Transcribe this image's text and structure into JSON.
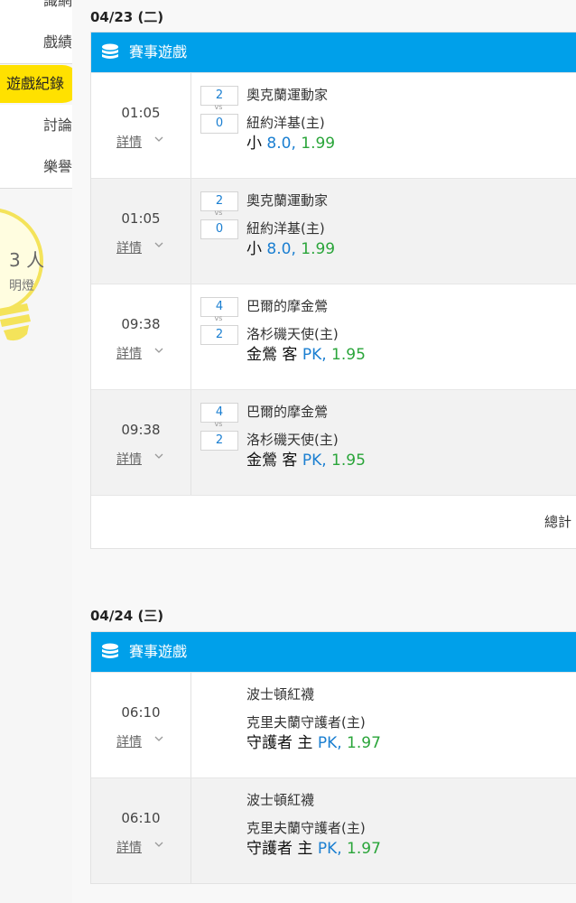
{
  "sidebar": {
    "items": [
      {
        "label": "識網"
      },
      {
        "label": "戲績"
      },
      {
        "label": "遊戲紀錄"
      },
      {
        "label": "討論"
      },
      {
        "label": "樂譽"
      }
    ],
    "bulb_count": "3 人",
    "bulb_label": "明燈"
  },
  "days": [
    {
      "date": "04/23 (二)",
      "section_title": "賽事遊戲",
      "games": [
        {
          "time": "01:05",
          "detail": "詳情",
          "away_score": "2",
          "home_score": "0",
          "vs": "vs",
          "away": "奧克蘭運動家",
          "home": "紐約洋基(主)",
          "pick": "小",
          "line": "8.0,",
          "odds": "1.99"
        },
        {
          "time": "01:05",
          "detail": "詳情",
          "away_score": "2",
          "home_score": "0",
          "vs": "vs",
          "away": "奧克蘭運動家",
          "home": "紐約洋基(主)",
          "pick": "小",
          "line": "8.0,",
          "odds": "1.99"
        },
        {
          "time": "09:38",
          "detail": "詳情",
          "away_score": "4",
          "home_score": "2",
          "vs": "vs",
          "away": "巴爾的摩金鶯",
          "home": "洛杉磯天使(主)",
          "pick": "金鶯 客",
          "line": "PK,",
          "odds": "1.95"
        },
        {
          "time": "09:38",
          "detail": "詳情",
          "away_score": "4",
          "home_score": "2",
          "vs": "vs",
          "away": "巴爾的摩金鶯",
          "home": "洛杉磯天使(主)",
          "pick": "金鶯 客",
          "line": "PK,",
          "odds": "1.95"
        }
      ],
      "total_label": "總計"
    },
    {
      "date": "04/24 (三)",
      "section_title": "賽事遊戲",
      "games": [
        {
          "time": "06:10",
          "detail": "詳情",
          "away": "波士頓紅襪",
          "home": "克里夫蘭守護者(主)",
          "pick": "守護者 主",
          "line": "PK,",
          "odds": "1.97"
        },
        {
          "time": "06:10",
          "detail": "詳情",
          "away": "波士頓紅襪",
          "home": "克里夫蘭守護者(主)",
          "pick": "守護者 主",
          "line": "PK,",
          "odds": "1.97"
        }
      ]
    }
  ],
  "colors": {
    "header_blue": "#00a0ea",
    "active_yellow": "#ffe100",
    "line_blue": "#1b7fd1",
    "odds_green": "#2aa53a"
  },
  "icons": [
    "coin-stack-icon",
    "chevron-down-icon",
    "lightbulb-icon"
  ]
}
